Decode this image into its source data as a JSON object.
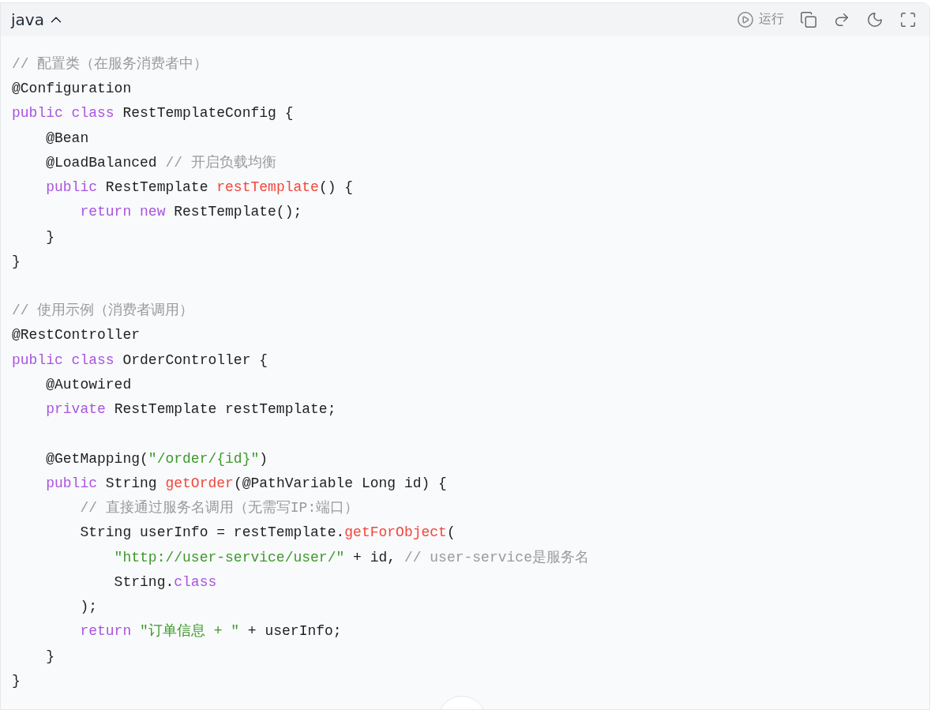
{
  "header": {
    "language": "java",
    "expanded": true,
    "run_label": "运行"
  },
  "lines": [
    {
      "kind": "code",
      "tokens": [
        {
          "kind": "comment",
          "text": "// 配置类（在服务消费者中）"
        }
      ]
    },
    {
      "kind": "code",
      "tokens": [
        {
          "kind": "plain",
          "text": "@Configuration"
        }
      ]
    },
    {
      "kind": "code",
      "tokens": [
        {
          "kind": "keyword",
          "text": "public class"
        },
        {
          "kind": "plain",
          "text": " RestTemplateConfig {"
        }
      ]
    },
    {
      "kind": "code",
      "tokens": [
        {
          "kind": "plain",
          "text": "    @Bean"
        }
      ]
    },
    {
      "kind": "code",
      "tokens": [
        {
          "kind": "plain",
          "text": "    @LoadBalanced "
        },
        {
          "kind": "comment",
          "text": "// 开启负载均衡"
        }
      ]
    },
    {
      "kind": "code",
      "tokens": [
        {
          "kind": "keyword",
          "text": "    public"
        },
        {
          "kind": "plain",
          "text": " RestTemplate "
        },
        {
          "kind": "function",
          "text": "restTemplate"
        },
        {
          "kind": "plain",
          "text": "() {"
        }
      ]
    },
    {
      "kind": "code",
      "tokens": [
        {
          "kind": "keyword",
          "text": "        return new"
        },
        {
          "kind": "plain",
          "text": " RestTemplate();"
        }
      ]
    },
    {
      "kind": "code",
      "tokens": [
        {
          "kind": "plain",
          "text": "    }"
        }
      ]
    },
    {
      "kind": "code",
      "tokens": [
        {
          "kind": "plain",
          "text": "}"
        }
      ]
    },
    {
      "kind": "blank"
    },
    {
      "kind": "code",
      "tokens": [
        {
          "kind": "comment",
          "text": "// 使用示例（消费者调用）"
        }
      ]
    },
    {
      "kind": "code",
      "tokens": [
        {
          "kind": "plain",
          "text": "@RestController"
        }
      ]
    },
    {
      "kind": "code",
      "tokens": [
        {
          "kind": "keyword",
          "text": "public class"
        },
        {
          "kind": "plain",
          "text": " OrderController {"
        }
      ]
    },
    {
      "kind": "code",
      "tokens": [
        {
          "kind": "plain",
          "text": "    @Autowired"
        }
      ]
    },
    {
      "kind": "code",
      "tokens": [
        {
          "kind": "keyword",
          "text": "    private"
        },
        {
          "kind": "plain",
          "text": " RestTemplate restTemplate;"
        }
      ]
    },
    {
      "kind": "blank"
    },
    {
      "kind": "code",
      "tokens": [
        {
          "kind": "plain",
          "text": "    @GetMapping("
        },
        {
          "kind": "string",
          "text": "\"/order/{id}\""
        },
        {
          "kind": "plain",
          "text": ")"
        }
      ]
    },
    {
      "kind": "code",
      "tokens": [
        {
          "kind": "keyword",
          "text": "    public"
        },
        {
          "kind": "plain",
          "text": " String "
        },
        {
          "kind": "function",
          "text": "getOrder"
        },
        {
          "kind": "plain",
          "text": "(@PathVariable Long id) {"
        }
      ]
    },
    {
      "kind": "code",
      "tokens": [
        {
          "kind": "comment",
          "text": "        // 直接通过服务名调用（无需写IP:端口）"
        }
      ]
    },
    {
      "kind": "code",
      "tokens": [
        {
          "kind": "plain",
          "text": "        String userInfo = restTemplate."
        },
        {
          "kind": "function",
          "text": "getForObject"
        },
        {
          "kind": "plain",
          "text": "("
        }
      ]
    },
    {
      "kind": "code",
      "tokens": [
        {
          "kind": "string",
          "text": "            \"http://user-service/user/\""
        },
        {
          "kind": "plain",
          "text": " + id, "
        },
        {
          "kind": "comment",
          "text": "// user-service是服务名"
        }
      ]
    },
    {
      "kind": "code",
      "tokens": [
        {
          "kind": "plain",
          "text": "            String."
        },
        {
          "kind": "keyword",
          "text": "class"
        }
      ]
    },
    {
      "kind": "code",
      "tokens": [
        {
          "kind": "plain",
          "text": "        );"
        }
      ]
    },
    {
      "kind": "code",
      "tokens": [
        {
          "kind": "keyword",
          "text": "        return "
        },
        {
          "kind": "string",
          "text": "\"订单信息 + \""
        },
        {
          "kind": "plain",
          "text": " + userInfo;"
        }
      ]
    },
    {
      "kind": "code",
      "tokens": [
        {
          "kind": "plain",
          "text": "    }"
        }
      ]
    },
    {
      "kind": "code",
      "tokens": [
        {
          "kind": "plain",
          "text": "}"
        }
      ]
    }
  ]
}
